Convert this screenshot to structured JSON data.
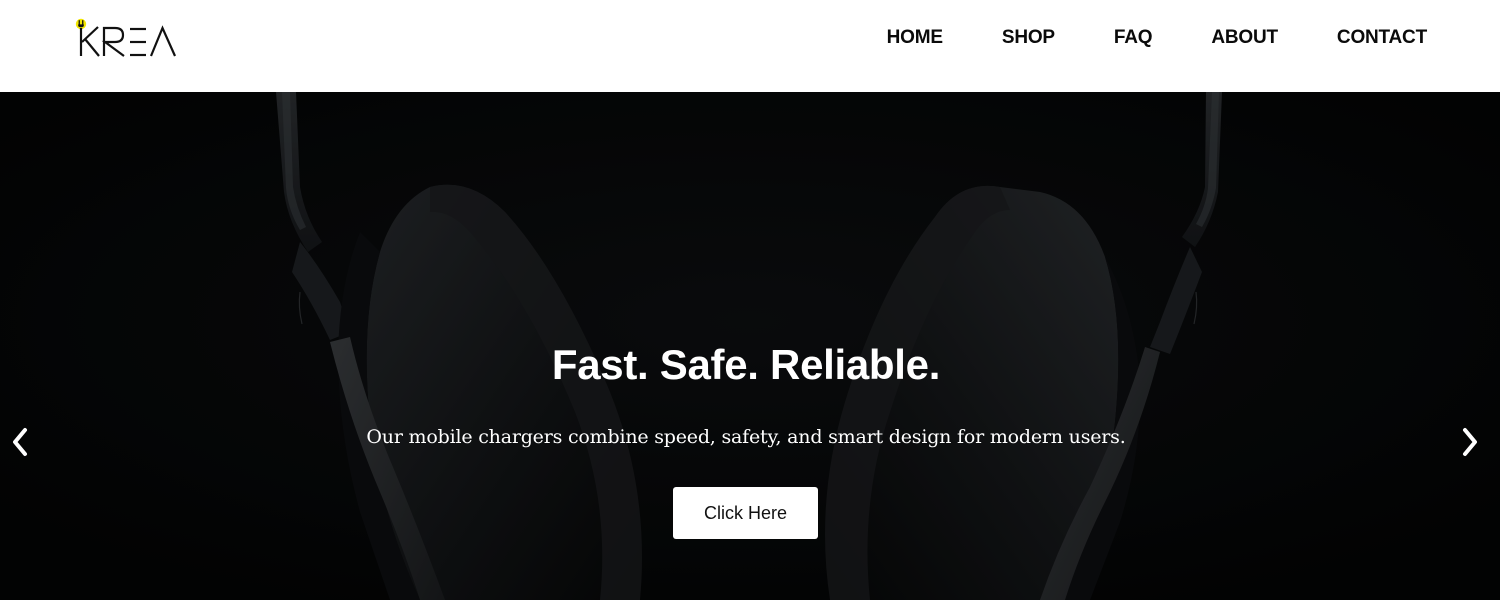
{
  "brand": {
    "logo_text": "KREA",
    "accent_color": "#f2e600"
  },
  "nav": {
    "items": [
      {
        "label": "HOME"
      },
      {
        "label": "SHOP"
      },
      {
        "label": "FAQ"
      },
      {
        "label": "ABOUT"
      },
      {
        "label": "CONTACT"
      }
    ]
  },
  "hero": {
    "title": "Fast. Safe. Reliable.",
    "subtitle": "Our mobile chargers combine speed, safety, and smart design for modern users.",
    "button_label": "Click Here",
    "background_color": "#050607",
    "image_subject": "headphones",
    "prev_icon": "chevron-left-icon",
    "next_icon": "chevron-right-icon"
  }
}
